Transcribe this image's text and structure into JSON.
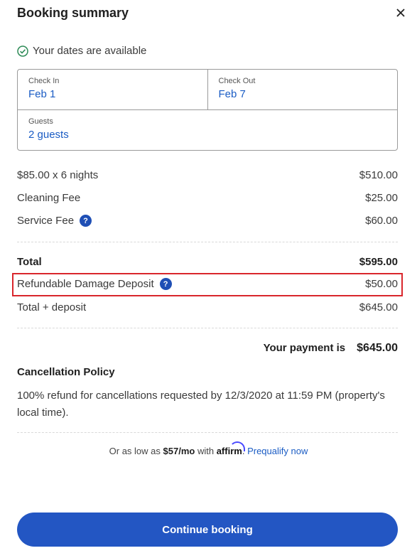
{
  "header": {
    "title": "Booking summary",
    "close_icon": "close-icon"
  },
  "availability": {
    "text": "Your dates are available",
    "icon": "check-circle-icon",
    "color": "#2e8b57"
  },
  "dates": {
    "check_in_label": "Check In",
    "check_in_value": "Feb 1",
    "check_out_label": "Check Out",
    "check_out_value": "Feb 7",
    "guests_label": "Guests",
    "guests_value": "2 guests"
  },
  "pricing": {
    "nightly_label": "$85.00 x 6 nights",
    "nightly_amount": "$510.00",
    "cleaning_label": "Cleaning Fee",
    "cleaning_amount": "$25.00",
    "service_label": "Service Fee",
    "service_amount": "$60.00",
    "total_label": "Total",
    "total_amount": "$595.00",
    "deposit_label": "Refundable Damage Deposit",
    "deposit_amount": "$50.00",
    "total_deposit_label": "Total + deposit",
    "total_deposit_amount": "$645.00"
  },
  "payment": {
    "label": "Your payment is",
    "amount": "$645.00"
  },
  "policy": {
    "title": "Cancellation Policy",
    "text": "100% refund for cancellations requested by 12/3/2020 at 11:59 PM (property's local time)."
  },
  "affirm": {
    "prefix": "Or as low as",
    "amount": "$57/mo",
    "with": "with",
    "brand": "affirm",
    "suffix": ".",
    "link": "Prequalify now"
  },
  "cta": {
    "label": "Continue booking"
  },
  "colors": {
    "accent": "#2356c3",
    "link": "#1a5cc4",
    "highlight": "#d9262c"
  }
}
